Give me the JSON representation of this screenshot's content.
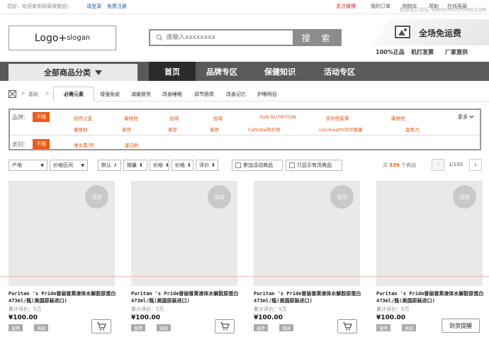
{
  "topbar": {
    "welcome": "您好，欢迎来到网易保健品！",
    "login": "请登录",
    "register": "免费注册",
    "right_links": [
      "关注微博",
      "我的订单",
      "购物车",
      "帮助",
      "在线客服"
    ],
    "watermark": "思缘设计论坛",
    "watermark_url": "WWW.MISSYUAN.COM"
  },
  "header": {
    "logo": "Logo+",
    "logo_sub": "slogan",
    "search_placeholder": "请输入xxxxxxxx",
    "search_button": "搜 索",
    "promo_text": "全场免运费",
    "guarantees": [
      "100%正品",
      "机打发票",
      "厂家直供"
    ]
  },
  "nav": {
    "all_categories": "全部商品分类",
    "items": [
      "首页",
      "品牌专区",
      "保健知识",
      "活动专区"
    ]
  },
  "breadcrumb": {
    "home": "基础",
    "tabs": [
      "必需元素",
      "增强免疫",
      "减缓疲劳",
      "改善睡眠",
      "调节肠胃",
      "改善记忆",
      "护眼明目"
    ]
  },
  "filters": {
    "brand_label": "品牌:",
    "no_limit": "不限",
    "brands_row1": [
      "自然之宝",
      "康维他",
      "加城",
      "加城",
      "SUN NUTRITION",
      "安利纽崔莱",
      "康维他"
    ],
    "brands_row2": [
      "康维他",
      "善存",
      "善存",
      "善存",
      "Caltrate钙尔奇",
      "cocohealth可尔斯康",
      "金奥力"
    ],
    "more": "更多",
    "category_label": "类别:",
    "categories": [
      "维生素/钙",
      "蛋白粉"
    ]
  },
  "sortbar": {
    "region": "产地",
    "price_range": "价格区间",
    "default": "默认",
    "sales": "销量",
    "price_down": "价格",
    "price_up": "价格",
    "rating": "评价",
    "activity_only": "参加活动商品",
    "in_stock_only": "只显示有货商品",
    "total_prefix": "共",
    "total_count": "539",
    "total_suffix": "个商品",
    "pager": "1/100"
  },
  "products": [
    {
      "badge": "活动",
      "title": "Puritan 's Pride普丽普莱液体水解胶原蛋白473ml/瓶(美国原装进口)",
      "review": "累计评价：5万",
      "price": "¥100.00",
      "tags": [
        "直降",
        "满减"
      ]
    },
    {
      "badge": "活动",
      "title": "Puritan 's Pride普丽普莱液体水解胶原蛋白473ml/瓶(美国原装进口)",
      "review": "累计评价：5万",
      "price": "¥100.00",
      "tags": [
        "直降",
        "满减"
      ]
    },
    {
      "badge": "活动",
      "title": "Puritan 's Pride普丽普莱液体水解胶原蛋白473ml/瓶(美国原装进口)",
      "review": "累计评价：5万",
      "price": "¥100.00",
      "tags": [
        "直降",
        "满减"
      ]
    },
    {
      "badge": "活动",
      "title": "Puritan 's Pride普丽普莱液体水解胶原蛋白473ml/瓶(美国原装进口)",
      "review": "累计评价：5万",
      "price": "¥100.00",
      "tags": [
        "直降",
        "满减"
      ],
      "notify": "到货提醒"
    }
  ],
  "colors": {
    "accent": "#f05a14",
    "nav": "#5a5a5a",
    "nav_active": "#2b2b2b",
    "link": "#1a5ea8"
  }
}
